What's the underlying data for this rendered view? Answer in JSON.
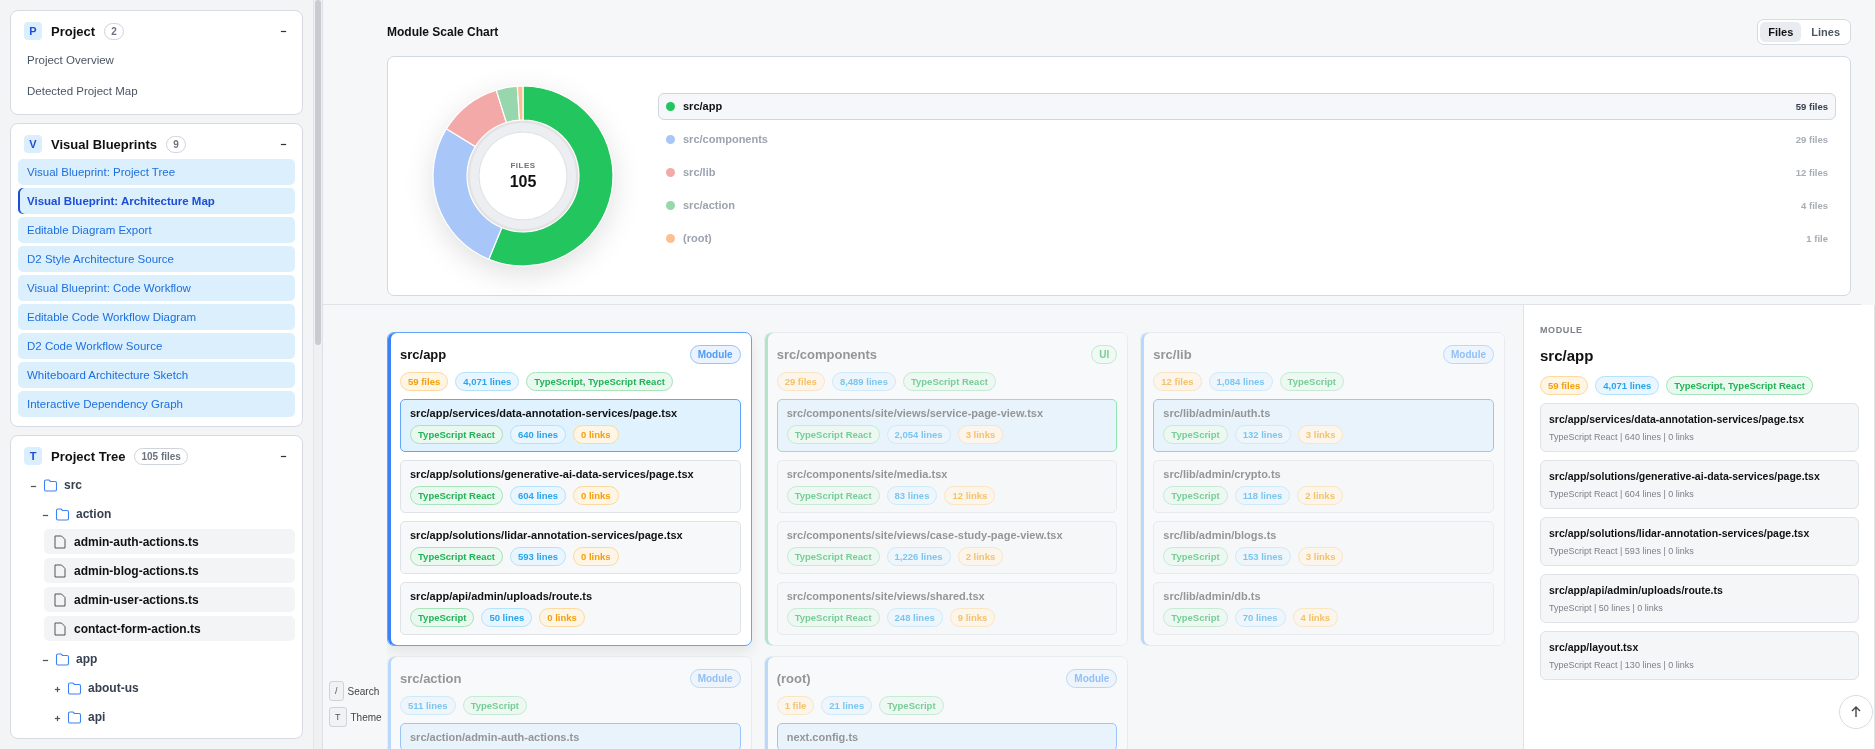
{
  "sidebar": {
    "sections": [
      {
        "kind": "links",
        "badge": "P",
        "title": "Project",
        "count": "2",
        "expanded": true,
        "items": [
          {
            "label": "Project Overview",
            "selected": false
          },
          {
            "label": "Detected Project Map",
            "selected": false
          }
        ]
      },
      {
        "kind": "blueprints",
        "badge": "V",
        "title": "Visual Blueprints",
        "count": "9",
        "expanded": true,
        "items": [
          {
            "label": "Visual Blueprint: Project Tree",
            "selected": false
          },
          {
            "label": "Visual Blueprint: Architecture Map",
            "selected": true
          },
          {
            "label": "Editable Diagram Export",
            "selected": false
          },
          {
            "label": "D2 Style Architecture Source",
            "selected": false
          },
          {
            "label": "Visual Blueprint: Code Workflow",
            "selected": false
          },
          {
            "label": "Editable Code Workflow Diagram",
            "selected": false
          },
          {
            "label": "D2 Code Workflow Source",
            "selected": false
          },
          {
            "label": "Whiteboard Architecture Sketch",
            "selected": false
          },
          {
            "label": "Interactive Dependency Graph",
            "selected": false
          }
        ]
      },
      {
        "kind": "tree",
        "badge": "T",
        "title": "Project Tree",
        "count": "105 files",
        "expanded": true,
        "tree": [
          {
            "name": "src",
            "expanded": true,
            "children": [
              {
                "name": "action",
                "expanded": true,
                "children": [
                  {
                    "name": "admin-auth-actions.ts"
                  },
                  {
                    "name": "admin-blog-actions.ts"
                  },
                  {
                    "name": "admin-user-actions.ts"
                  },
                  {
                    "name": "contact-form-action.ts"
                  }
                ]
              },
              {
                "name": "app",
                "expanded": true,
                "children": [
                  {
                    "name": "about-us",
                    "expanded": false
                  },
                  {
                    "name": "api",
                    "expanded": false
                  }
                ]
              }
            ]
          }
        ]
      }
    ]
  },
  "chart_section": {
    "title": "Module Scale Chart",
    "toggle": [
      {
        "label": "Files",
        "selected": true
      },
      {
        "label": "Lines",
        "selected": false
      }
    ],
    "center_label": "FILES",
    "center_value": "105",
    "legend": [
      {
        "count": "59 files",
        "color": "#22c55e",
        "selected": true
      },
      {
        "count": "29 files",
        "color": "#a9c6f8",
        "selected": false
      },
      {
        "count": "12 files",
        "color": "#f4a9a9",
        "selected": false
      },
      {
        "count": "4 files",
        "color": "#98d6ae",
        "selected": false
      },
      {
        "count": "1 file",
        "color": "#fbbf94",
        "selected": false
      }
    ],
    "chart_data": {
      "type": "donut",
      "legend": true,
      "categories": [
        "src/app",
        "src/components",
        "src/lib",
        "src/action",
        "(root)"
      ],
      "values": [
        56.2,
        27.6,
        11.4,
        3.8,
        1.0
      ]
    }
  },
  "modules": [
    {
      "name": "src/app",
      "tag": "Module",
      "kind": "module",
      "selected": true,
      "files": "59 files",
      "lines": "4,071 lines",
      "languages": "TypeScript, TypeScript React",
      "entries": [
        {
          "path": "src/app/services/data-annotation-services/page.tsx",
          "lang": "TypeScript React",
          "lines": "640 lines",
          "links": "0 links",
          "selected": true
        },
        {
          "path": "src/app/solutions/generative-ai-data-services/page.tsx",
          "lang": "TypeScript React",
          "lines": "604 lines",
          "links": "0 links",
          "selected": false
        },
        {
          "path": "src/app/solutions/lidar-annotation-services/page.tsx",
          "lang": "TypeScript React",
          "lines": "593 lines",
          "links": "0 links",
          "selected": false
        },
        {
          "path": "src/app/api/admin/uploads/route.ts",
          "lang": "TypeScript",
          "lines": "50 lines",
          "links": "0 links",
          "selected": false
        }
      ]
    },
    {
      "name": "src/components",
      "tag": "UI",
      "kind": "ui",
      "selected": false,
      "files": "29 files",
      "lines": "8,489 lines",
      "languages": "TypeScript React",
      "entries": [
        {
          "path": "src/components/site/views/service-page-view.tsx",
          "lang": "TypeScript React",
          "lines": "2,054 lines",
          "links": "3 links",
          "selected": true
        },
        {
          "path": "src/components/site/media.tsx",
          "lang": "TypeScript React",
          "lines": "83 lines",
          "links": "12 links",
          "selected": false
        },
        {
          "path": "src/components/site/views/case-study-page-view.tsx",
          "lang": "TypeScript React",
          "lines": "1,226 lines",
          "links": "2 links",
          "selected": false
        },
        {
          "path": "src/components/site/views/shared.tsx",
          "lang": "TypeScript React",
          "lines": "248 lines",
          "links": "9 links",
          "selected": false
        }
      ]
    },
    {
      "name": "src/lib",
      "tag": "Module",
      "kind": "module",
      "selected": false,
      "files": "12 files",
      "lines": "1,084 lines",
      "languages": "TypeScript",
      "entries": [
        {
          "path": "src/lib/admin/auth.ts",
          "lang": "TypeScript",
          "lines": "132 lines",
          "links": "3 links",
          "selected": true
        },
        {
          "path": "src/lib/admin/crypto.ts",
          "lang": "TypeScript",
          "lines": "118 lines",
          "links": "2 links",
          "selected": false
        },
        {
          "path": "src/lib/admin/blogs.ts",
          "lang": "TypeScript",
          "lines": "153 lines",
          "links": "3 links",
          "selected": false
        },
        {
          "path": "src/lib/admin/db.ts",
          "lang": "TypeScript",
          "lines": "70 lines",
          "links": "4 links",
          "selected": false
        }
      ]
    },
    {
      "name": "src/action",
      "tag": "Module",
      "kind": "module",
      "selected": false,
      "lines": "511 lines",
      "languages": "TypeScript",
      "entries": [
        {
          "path": "src/action/admin-auth-actions.ts",
          "selected": true
        }
      ]
    },
    {
      "name": "(root)",
      "tag": "Module",
      "kind": "module",
      "selected": false,
      "files": "1 file",
      "lines": "21 lines",
      "languages": "TypeScript",
      "entries": [
        {
          "path": "next.config.ts",
          "selected": true
        }
      ]
    }
  ],
  "detail": {
    "label": "MODULE",
    "title": "src/app",
    "files": "59 files",
    "lines": "4,071 lines",
    "languages": "TypeScript, TypeScript React",
    "entries": [
      {
        "path": "src/app/services/data-annotation-services/page.tsx",
        "meta": "TypeScript React | 640 lines | 0 links"
      },
      {
        "path": "src/app/solutions/generative-ai-data-services/page.tsx",
        "meta": "TypeScript React | 604 lines | 0 links"
      },
      {
        "path": "src/app/solutions/lidar-annotation-services/page.tsx",
        "meta": "TypeScript React | 593 lines | 0 links"
      },
      {
        "path": "src/app/api/admin/uploads/route.ts",
        "meta": "TypeScript | 50 lines | 0 links"
      },
      {
        "path": "src/app/layout.tsx",
        "meta": "TypeScript React | 130 lines | 0 links"
      }
    ]
  },
  "shortcuts": [
    {
      "key": "/",
      "label": "Search"
    },
    {
      "key": "T",
      "label": "Theme"
    }
  ]
}
